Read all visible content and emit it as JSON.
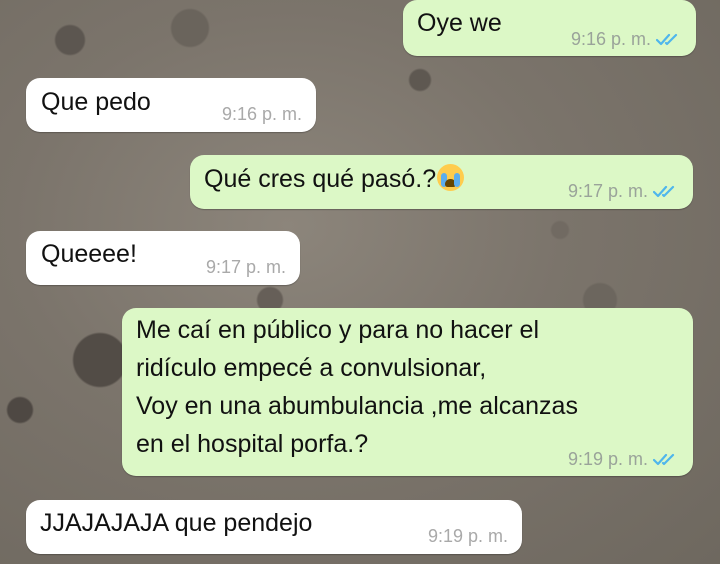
{
  "messages": [
    {
      "direction": "out",
      "text": "Oye we",
      "time": "9:16 p. m.",
      "read": true
    },
    {
      "direction": "in",
      "text": "Que pedo",
      "time": "9:16 p. m."
    },
    {
      "direction": "out",
      "text": "Qué cres qué pasó.?",
      "emoji": "loudly-crying-face",
      "time": "9:17 p. m.",
      "read": true
    },
    {
      "direction": "in",
      "text": "Queeee!",
      "time": "9:17 p. m."
    },
    {
      "direction": "out",
      "text": "Me caí en público y para no hacer el\nridículo empecé a convulsionar,\nVoy en una abumbulancia ,me alcanzas\nen el hospital porfa.?",
      "time": "9:19 p. m.",
      "read": true
    },
    {
      "direction": "in",
      "text": "JJAJAJAJA que pendejo",
      "time": "9:19 p. m."
    }
  ],
  "colors": {
    "outgoing_bubble": "#dcf8c6",
    "incoming_bubble": "#ffffff",
    "read_ticks": "#4fb6ec"
  }
}
